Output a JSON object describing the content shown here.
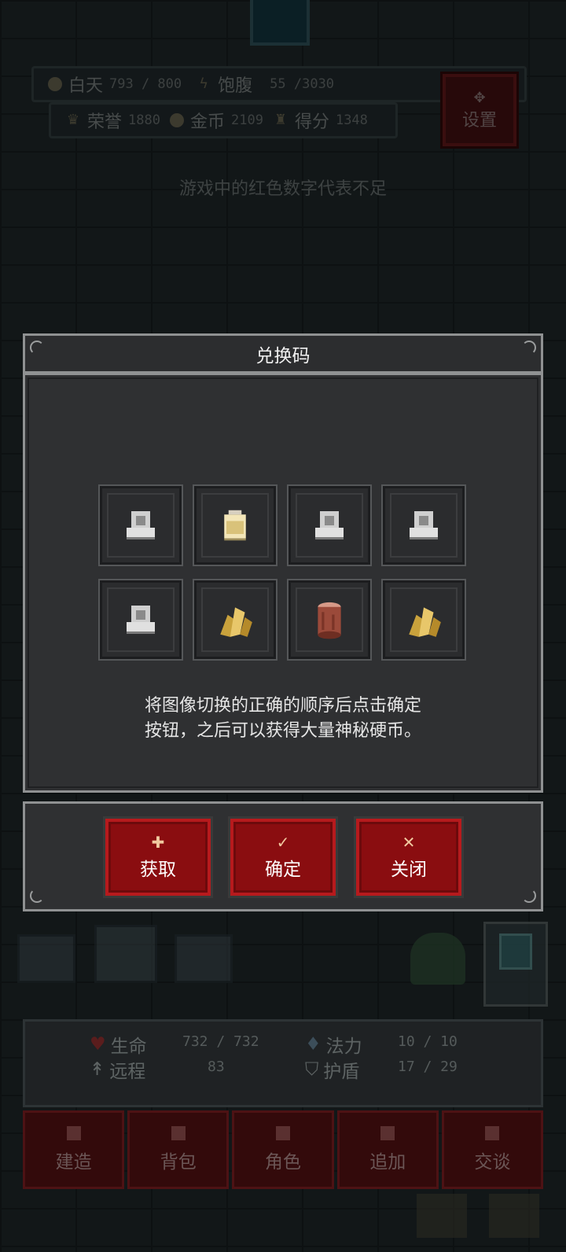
{
  "hud": {
    "daytime_label": "白天",
    "daytime_value": "793 / 800",
    "hunger_label": "饱腹",
    "hunger_value": "55 /3030",
    "honor_label": "荣誉",
    "honor_value": "1880",
    "gold_label": "金币",
    "gold_value": "2109",
    "score_label": "得分",
    "score_value": "1348",
    "settings_label": "设置"
  },
  "hint": "游戏中的红色数字代表不足",
  "dialog": {
    "title": "兑换码",
    "slots": [
      {
        "icon": "stone-throne-icon"
      },
      {
        "icon": "jar-icon"
      },
      {
        "icon": "stone-throne-icon"
      },
      {
        "icon": "stone-throne-icon"
      },
      {
        "icon": "stone-throne-icon"
      },
      {
        "icon": "gold-crystal-icon"
      },
      {
        "icon": "wood-log-icon"
      },
      {
        "icon": "gold-crystal-icon"
      }
    ],
    "description_line1": "将图像切换的正确的顺序后点击确定",
    "description_line2": "按钮，之后可以获得大量神秘硬币。",
    "buttons": {
      "get_label": "获取",
      "confirm_label": "确定",
      "close_label": "关闭"
    }
  },
  "stats": {
    "hp_label": "生命",
    "hp_value": "732 / 732",
    "mana_label": "法力",
    "mana_value": "10 / 10",
    "ranged_label": "远程",
    "ranged_value": "83",
    "shield_label": "护盾",
    "shield_value": "17 / 29"
  },
  "nav": {
    "build": "建造",
    "bag": "背包",
    "role": "角色",
    "add": "追加",
    "talk": "交谈"
  },
  "colors": {
    "button_red": "#8a0d10",
    "panel": "#2f3032",
    "frame": "#8f9192"
  }
}
